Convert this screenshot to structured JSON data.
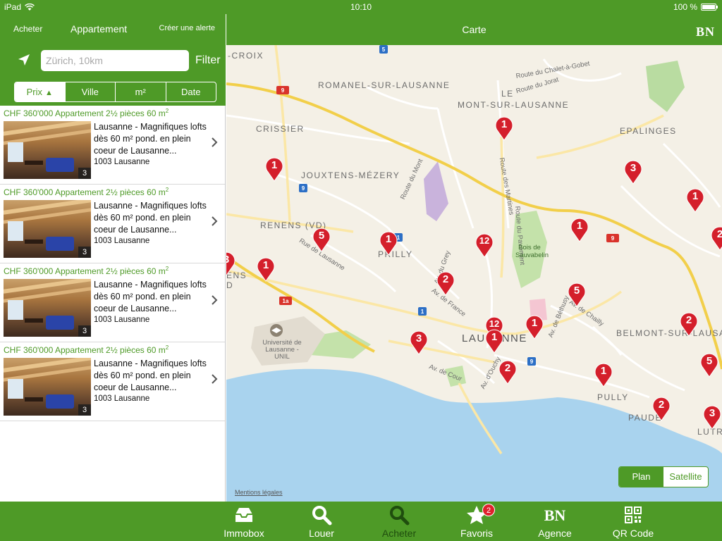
{
  "status": {
    "device": "iPad",
    "time": "10:10",
    "battery": "100 %"
  },
  "left": {
    "nav": {
      "left": "Acheter",
      "center": "Appartement",
      "right": "Créer une alerte"
    },
    "search": {
      "placeholder": "Zürich, 10km",
      "filter": "Filter"
    },
    "sort": [
      "Prix",
      "Ville",
      "m²",
      "Date"
    ],
    "listings": [
      {
        "title_main": "CHF 360'000 Appartement 2½ pièces 60 m",
        "title_sup": "2",
        "desc": "Lausanne - Magnifiques lofts dès 60 m² pond. en plein coeur de Lausanne...",
        "city": "1003 Lausanne",
        "photos": "3"
      },
      {
        "title_main": "CHF 360'000 Appartement 2½ pièces 60 m",
        "title_sup": "2",
        "desc": "Lausanne - Magnifiques lofts dès 60 m² pond. en plein coeur de Lausanne...",
        "city": "1003 Lausanne",
        "photos": "3"
      },
      {
        "title_main": "CHF 360'000 Appartement 2½ pièces 60 m",
        "title_sup": "2",
        "desc": "Lausanne - Magnifiques lofts dès 60 m² pond. en plein coeur de Lausanne...",
        "city": "1003 Lausanne",
        "photos": "3"
      },
      {
        "title_main": "CHF 360'000 Appartement 2½ pièces 60 m",
        "title_sup": "2",
        "desc": "Lausanne - Magnifiques lofts dès 60 m² pond. en plein coeur de Lausanne...",
        "city": "1003 Lausanne",
        "photos": "3"
      }
    ]
  },
  "map": {
    "title": "Carte",
    "brand": "BN",
    "legal": "Mentions légales",
    "types": [
      "Plan",
      "Satellite"
    ],
    "labels": {
      "croix": "-CROIX",
      "romanel": "ROMANEL-SUR-LAUSANNE",
      "mont": "MONT-SUR-LAUSANNE",
      "le": "LE",
      "crissier": "CRISSIER",
      "epalinges": "EPALINGES",
      "jouxtens": "JOUXTENS-MÉZERY",
      "renens": "RENENS (VD)",
      "prilly": "PRILLY",
      "lausanne": "LAUSANNE",
      "pully": "PULLY",
      "belmont": "BELMONT-SUR-LAUSAN",
      "paudex": "PAUDE",
      "lutry": "LUTR",
      "ens": "ENS",
      "d": "D",
      "unil": "Université de Lausanne - UNIL"
    },
    "roads": {
      "chalet": "Route du Chalet-à-Gobet",
      "jorat": "Route du Jorat",
      "martines": "Route des Martines",
      "pavement": "Route du Pavement",
      "sauvabelin": "Bois de Sauvabelin",
      "lausanne": "Rue de Lausanne",
      "grey": "Av. du Grey",
      "france": "Av. de France",
      "cour": "Av. de Cour",
      "ouchy": "Av. d'Ouchy",
      "chailly": "Av. de Chailly",
      "bethusy": "Av. de Béthusy",
      "mont": "Route du Mont"
    },
    "pins": [
      "1",
      "1",
      "3",
      "1",
      "1",
      "5",
      "1",
      "12",
      "1",
      "2",
      "1",
      "5",
      "12",
      "1",
      "1",
      "3",
      "2",
      "2",
      "1",
      "5",
      "2",
      "3",
      "2",
      "3"
    ]
  },
  "tabs": [
    {
      "label": "Immobox",
      "icon": "inbox-icon"
    },
    {
      "label": "Louer",
      "icon": "search-icon"
    },
    {
      "label": "Acheter",
      "icon": "search-icon"
    },
    {
      "label": "Favoris",
      "icon": "star-icon",
      "badge": "2"
    },
    {
      "label": "Agence",
      "icon": "bn-logo-icon",
      "glyph": "BN"
    },
    {
      "label": "QR Code",
      "icon": "qr-code-icon"
    }
  ],
  "colors": {
    "brand": "#4e9a27",
    "pin": "#d41f2b",
    "water": "#a9d3ee"
  }
}
